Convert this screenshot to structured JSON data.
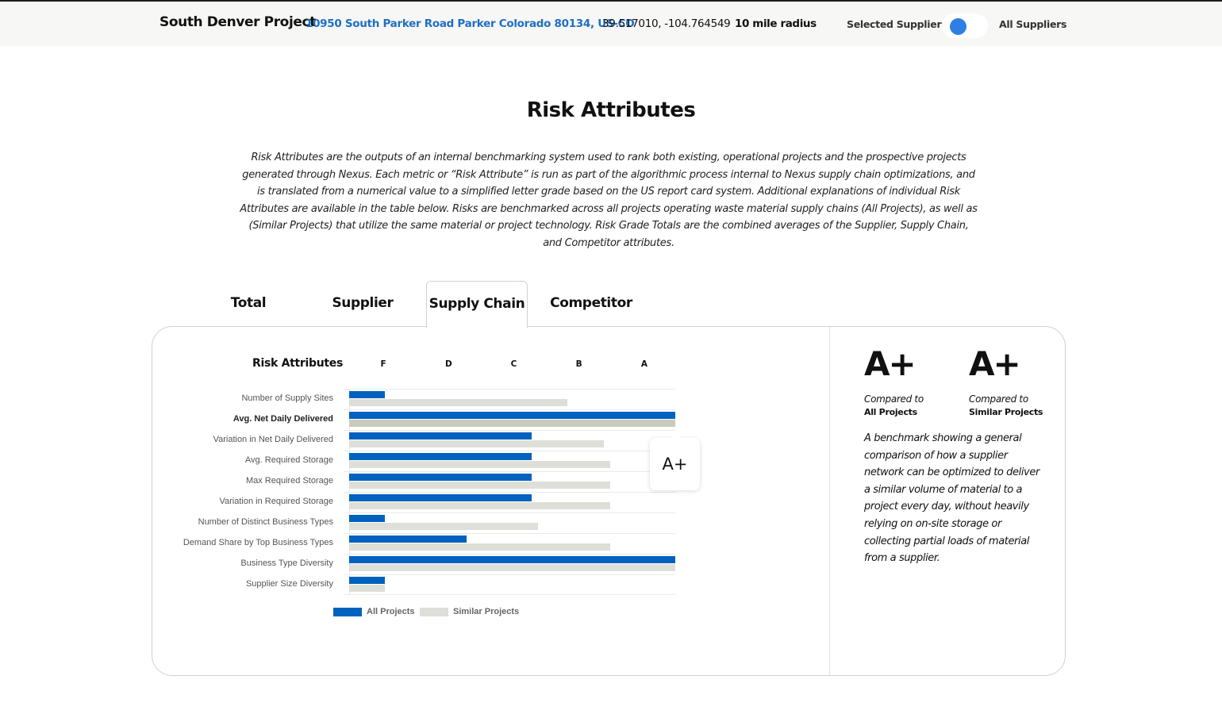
{
  "header": {
    "project_title": "South Denver Project",
    "address": "10950 South Parker Road Parker Colorado 80134, US-CO",
    "coordinates": "39.517010, -104.764549",
    "radius": "10 mile radius",
    "toggle": {
      "left_label": "Selected Suppliers",
      "right_label": "All Suppliers",
      "selected": "Selected Suppliers",
      "accent_color": "#2f7ee6"
    }
  },
  "page": {
    "title": "Risk Attributes",
    "intro": "Risk Attributes are the outputs of an internal benchmarking system used to rank both existing, operational projects and the prospective projects generated through Nexus. Each metric or “Risk Attribute” is run as part of the algorithmic process internal to Nexus supply chain optimizations, and is translated from a numerical value to a simplified letter grade based on the US report card system. Additional explanations of individual Risk Attributes are available in the table below. Risks are benchmarked across all projects operating waste material supply chains (All Projects), as well as (Similar Projects) that utilize the same material or project technology. Risk Grade Totals are the combined averages of the Supplier, Supply Chain, and Competitor attributes."
  },
  "tabs": [
    {
      "label": "Total",
      "active": false
    },
    {
      "label": "Supplier",
      "active": false
    },
    {
      "label": "Supply Chain",
      "active": true
    },
    {
      "label": "Competitor",
      "active": false
    }
  ],
  "chart_data": {
    "type": "bar",
    "orientation": "horizontal",
    "title": "Risk Attributes",
    "xlabel": "",
    "ylabel": "",
    "x_tick_labels": [
      "F",
      "D",
      "C",
      "B",
      "A"
    ],
    "xlim": [
      0,
      100
    ],
    "grid": true,
    "legend_position": "bottom-left",
    "categories": [
      "Number of Supply Sites",
      "Avg. Net Daily Delivered",
      "Variation in Net Daily Delivered",
      "Avg. Required Storage",
      "Max Required Storage",
      "Variation in Required Storage",
      "Number of Distinct Business Types",
      "Demand Share by Top Business Types",
      "Business Type Diversity",
      "Supplier Size Diversity"
    ],
    "highlighted_category": "Avg. Net Daily Delivered",
    "series": [
      {
        "name": "All Projects",
        "color": "#0062be",
        "values": [
          11,
          100,
          56,
          56,
          56,
          56,
          11,
          36,
          100,
          11
        ]
      },
      {
        "name": "Similar Projects",
        "color": "#dedfd8",
        "values": [
          67,
          100,
          78,
          80,
          80,
          80,
          58,
          80,
          100,
          11
        ]
      }
    ],
    "tooltip": "A+"
  },
  "summary": {
    "all_projects": {
      "grade": "A+",
      "compared_to": "Compared to",
      "label": "All Projects"
    },
    "similar_projects": {
      "grade": "A+",
      "compared_to": "Compared to",
      "label": "Similar Projects"
    },
    "description": "A benchmark showing a general comparison of how a supplier network can be optimized to deliver a similar volume of material to a project every day, without heavily relying on on-site storage or collecting partial loads of material from a supplier."
  }
}
